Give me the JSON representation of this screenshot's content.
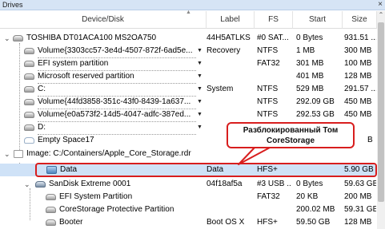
{
  "panel": {
    "title": "Drives",
    "close": "×"
  },
  "columns": {
    "device": "Device/Disk",
    "label": "Label",
    "fs": "FS",
    "start": "Start",
    "size": "Size"
  },
  "rows": [
    {
      "name": "TOSHIBA DT01ACA100 MS2OA750",
      "label": "44H5ATLKS",
      "fs": "#0 SAT...",
      "start": "0 Bytes",
      "size": "931.51 ..."
    },
    {
      "name": "Volume{3303cc57-3e4d-4507-872f-6ad5e...",
      "label": "Recovery",
      "fs": "NTFS",
      "start": "1 MB",
      "size": "300 MB"
    },
    {
      "name": "EFI system partition",
      "label": "",
      "fs": "FAT32",
      "start": "301 MB",
      "size": "100 MB"
    },
    {
      "name": "Microsoft reserved partition",
      "label": "",
      "fs": "",
      "start": "401 MB",
      "size": "128 MB"
    },
    {
      "name": "C:",
      "label": "System",
      "fs": "NTFS",
      "start": "529 MB",
      "size": "291.57 ..."
    },
    {
      "name": "Volume{44fd3858-351c-43f0-8439-1a637...",
      "label": "",
      "fs": "NTFS",
      "start": "292.09 GB",
      "size": "450 MB"
    },
    {
      "name": "Volume{e0a573f2-14d5-4047-adfc-387ed...",
      "label": "",
      "fs": "NTFS",
      "start": "292.53 GB",
      "size": "450 MB"
    },
    {
      "name": "D:",
      "label": "",
      "fs": "",
      "start": "",
      "size": ""
    },
    {
      "name": "Empty Space17",
      "label": "",
      "fs": "",
      "start": "",
      "size": "B"
    },
    {
      "name": "Image: C:/Containers/Apple_Core_Storage.rdr",
      "label": "",
      "fs": "",
      "start": "",
      "size": ""
    },
    {
      "name": "Data",
      "label": "Data",
      "fs": "HFS+",
      "start": "",
      "size": "5.90 GB"
    },
    {
      "name": "SanDisk Extreme 0001",
      "label": "04f18af5a",
      "fs": "#3 USB ...",
      "start": "0 Bytes",
      "size": "59.63 GB"
    },
    {
      "name": "EFI System Partition",
      "label": "",
      "fs": "FAT32",
      "start": "20 KB",
      "size": "200 MB"
    },
    {
      "name": "CoreStorage Protective Partition",
      "label": "",
      "fs": "",
      "start": "200.02 MB",
      "size": "59.31 GB"
    },
    {
      "name": "Booter",
      "label": "Boot OS X",
      "fs": "HFS+",
      "start": "59.50 GB",
      "size": "128 MB"
    }
  ],
  "callout": {
    "line1": "Разблокированный Том",
    "line2": "CoreStorage",
    "border_color": "#d81e1e"
  },
  "colors": {
    "selected_row": "#cfe2f7",
    "header_bar": "#d6e4f5"
  }
}
